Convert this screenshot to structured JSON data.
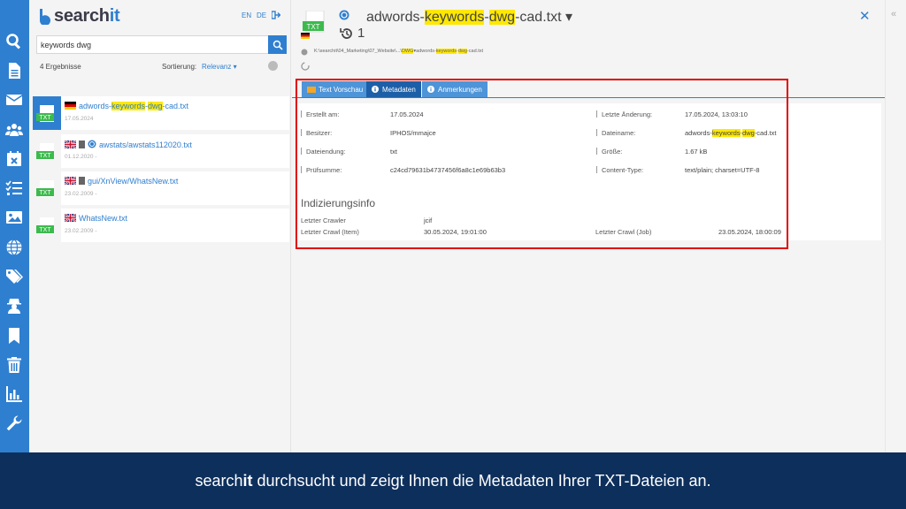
{
  "app": {
    "logo_prefix": "search",
    "logo_suffix": "it",
    "lang_en": "EN",
    "lang_de": "DE"
  },
  "search": {
    "value": "keywords dwg"
  },
  "results_header": {
    "count": "4 Ergebnisse",
    "sort_label": "Sortierung:",
    "sort_value": "Relevanz"
  },
  "results": [
    {
      "name_pre": "adwords-",
      "hl1": "keywords",
      "mid": "-",
      "hl2": "dwg",
      "name_post": "-cad.txt",
      "date": "17.05.2024",
      "flag": "de"
    },
    {
      "name": "awstats/awstats112020.txt",
      "date": "01.12.2020 -",
      "flag": "gb"
    },
    {
      "name": "gui/XnView/WhatsNew.txt",
      "date": "23.02.2009 -",
      "flag": "gb"
    },
    {
      "name": "WhatsNew.txt",
      "date": "23.02.2009 -",
      "flag": "gb"
    }
  ],
  "detail": {
    "title_pre": "adwords-",
    "title_hl1": "keywords",
    "title_mid": "-",
    "title_hl2": "dwg",
    "title_post": "-cad.txt",
    "version": "1",
    "path_pre": "K:\\searchit\\04_Marketing\\07_Website\\...\\",
    "path_hl": "DWG",
    "path_mid": "adwords-",
    "path_hl2": "keywords",
    "path_sep": "-",
    "path_hl3": "dwg",
    "path_post": "-cad.txt"
  },
  "tabs": [
    {
      "label": "Text Vorschau"
    },
    {
      "label": "Metadaten"
    },
    {
      "label": "Anmerkungen"
    }
  ],
  "metadata": {
    "created_label": "Erstellt am:",
    "created_value": "17.05.2024",
    "owner_label": "Besitzer:",
    "owner_value": "IPHOS/mmajce",
    "ext_label": "Dateiendung:",
    "ext_value": "txt",
    "checksum_label": "Prüfsumme:",
    "checksum_value": "c24cd79631b4737456f6a8c1e69b63b3",
    "modified_label": "Letzte Änderung:",
    "modified_value": "17.05.2024, 13:03:10",
    "filename_label": "Dateiname:",
    "filename_pre": "adwords-",
    "filename_hl1": "keywords",
    "filename_mid": "-",
    "filename_hl2": "dwg",
    "filename_post": "-cad.txt",
    "size_label": "Größe:",
    "size_value": "1.67 kB",
    "content_type_label": "Content-Type:",
    "content_type_value": "text/plain; charset=UTF-8"
  },
  "indexing": {
    "title": "Indizierungsinfo",
    "crawler_label": "Letzter Crawler",
    "crawler_value": "jcif",
    "crawl_item_label": "Letzter Crawl (Item)",
    "crawl_item_value": "30.05.2024, 19:01:00",
    "crawl_job_label": "Letzter Crawl (Job)",
    "crawl_job_value": "23.05.2024, 18:00:09"
  },
  "caption": {
    "pre": "search",
    "bold": "it",
    "post": " durchsucht und zeigt Ihnen die Metadaten Ihrer TXT-Dateien an."
  },
  "colors": {
    "brand": "#2f7fd0",
    "highlight": "#ffe800",
    "caption_bg": "#0d2f5c",
    "frame": "#e00000"
  }
}
